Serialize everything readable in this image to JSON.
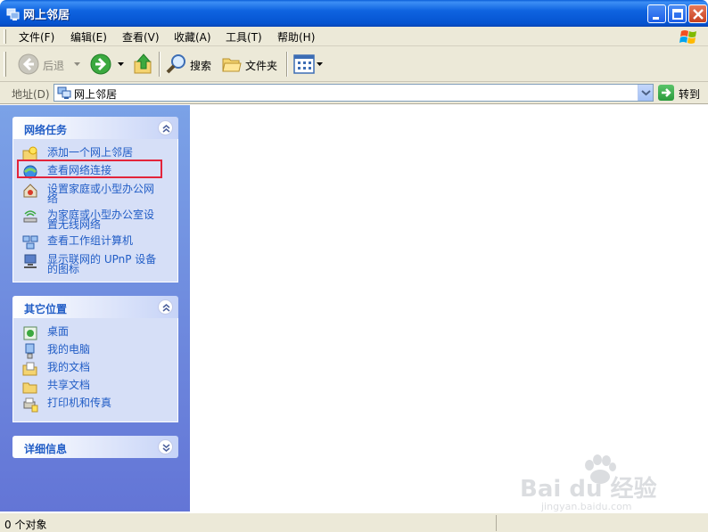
{
  "window": {
    "title": "网上邻居",
    "title_color": "#0553d0",
    "close_color": "#c7401f"
  },
  "menu": {
    "items": [
      "文件(F)",
      "编辑(E)",
      "查看(V)",
      "收藏(A)",
      "工具(T)",
      "帮助(H)"
    ]
  },
  "toolbar": {
    "back_label": "后退",
    "search_label": "搜索",
    "folders_label": "文件夹"
  },
  "address": {
    "label": "地址(D)",
    "value": "网上邻居",
    "go_label": "转到"
  },
  "panels": {
    "network_tasks": {
      "title": "网络任务",
      "items": [
        {
          "line1": "添加一个网上邻居",
          "icon": "add-network-place-icon"
        },
        {
          "line1": "查看网络连接",
          "icon": "network-connections-icon"
        },
        {
          "line1": "设置家庭或小型办公网",
          "line2": "络",
          "icon": "home-network-setup-icon"
        },
        {
          "line1": "为家庭或小型办公室设",
          "line2": "置无线网络",
          "icon": "wireless-network-icon"
        },
        {
          "line1": "查看工作组计算机",
          "icon": "workgroup-computers-icon"
        },
        {
          "line1": "显示联网的 UPnP 设备",
          "line2": "的图标",
          "icon": "upnp-device-icon"
        }
      ]
    },
    "other_places": {
      "title": "其它位置",
      "items": [
        {
          "line1": "桌面",
          "icon": "desktop-icon"
        },
        {
          "line1": "我的电脑",
          "icon": "my-computer-icon"
        },
        {
          "line1": "我的文档",
          "icon": "my-documents-icon"
        },
        {
          "line1": "共享文档",
          "icon": "shared-documents-icon"
        },
        {
          "line1": "打印机和传真",
          "icon": "printers-icon"
        }
      ]
    },
    "details": {
      "title": "详细信息"
    }
  },
  "status": {
    "text": "0 个对象"
  },
  "watermark": {
    "brand": "Bai du 经验",
    "url": "jingyan.baidu.com"
  },
  "colors": {
    "task_link": "#215dc6",
    "highlight_box": "#e3243b",
    "pane_top": "#7ba2e7",
    "pane_bottom": "#6375d6"
  }
}
